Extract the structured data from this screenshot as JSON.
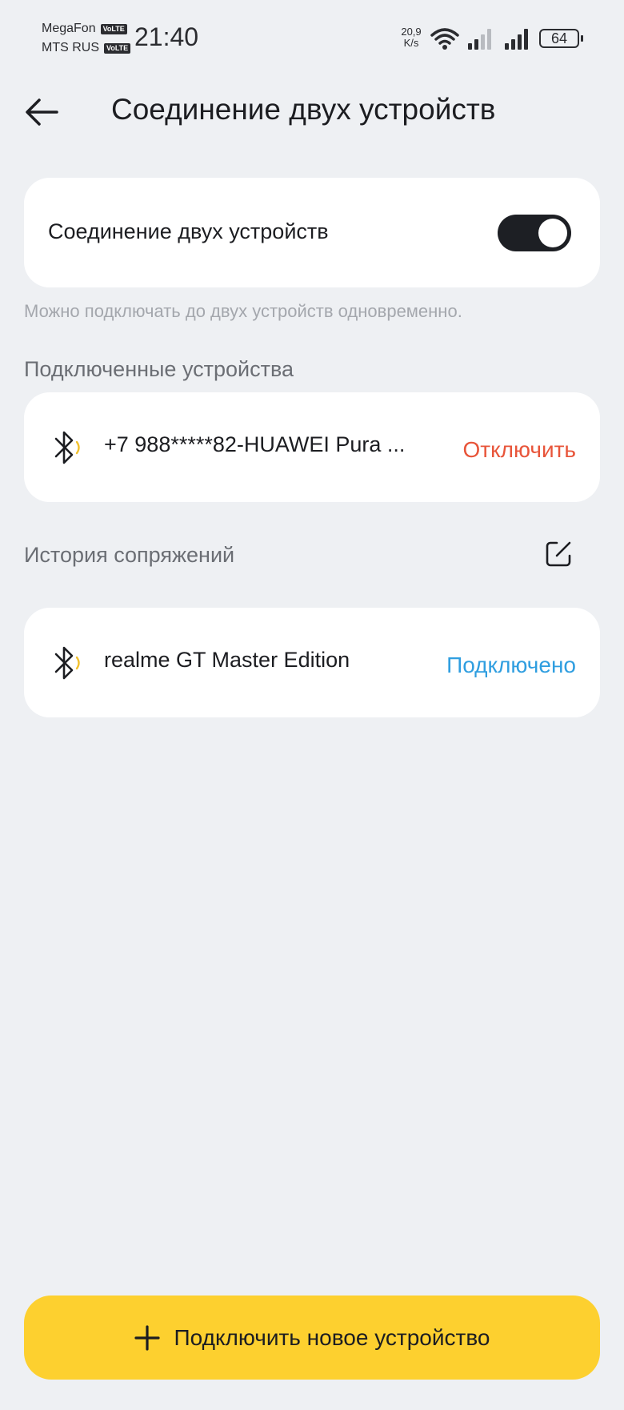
{
  "status_bar": {
    "carrier1": "MegaFon",
    "carrier2": "MTS RUS",
    "volte": "VoLTE",
    "time": "21:40",
    "speed_value": "20,9",
    "speed_unit": "K/s",
    "battery": "64"
  },
  "header": {
    "title": "Соединение двух устройств"
  },
  "dual_connection": {
    "label": "Соединение двух устройств",
    "enabled": true,
    "hint": "Можно подключать до двух устройств одновременно."
  },
  "connected": {
    "section_title": "Подключенные устройства",
    "devices": [
      {
        "name": "+7 988*****82-HUAWEI Pura ...",
        "action": "Отключить"
      }
    ]
  },
  "history": {
    "section_title": "История сопряжений",
    "devices": [
      {
        "name": "realme GT Master Edition",
        "action": "Подключено"
      }
    ]
  },
  "footer": {
    "add_label": "Подключить новое устройство"
  },
  "colors": {
    "background": "#eef0f3",
    "accent_yellow": "#fdd02f",
    "disconnect_red": "#e8553a",
    "connected_blue": "#2f9ee0",
    "bluetooth_wave": "#f2c12e"
  },
  "icons": [
    "back-arrow-icon",
    "bluetooth-icon",
    "edit-icon",
    "plus-icon",
    "wifi-icon",
    "signal-icon",
    "battery-icon"
  ]
}
